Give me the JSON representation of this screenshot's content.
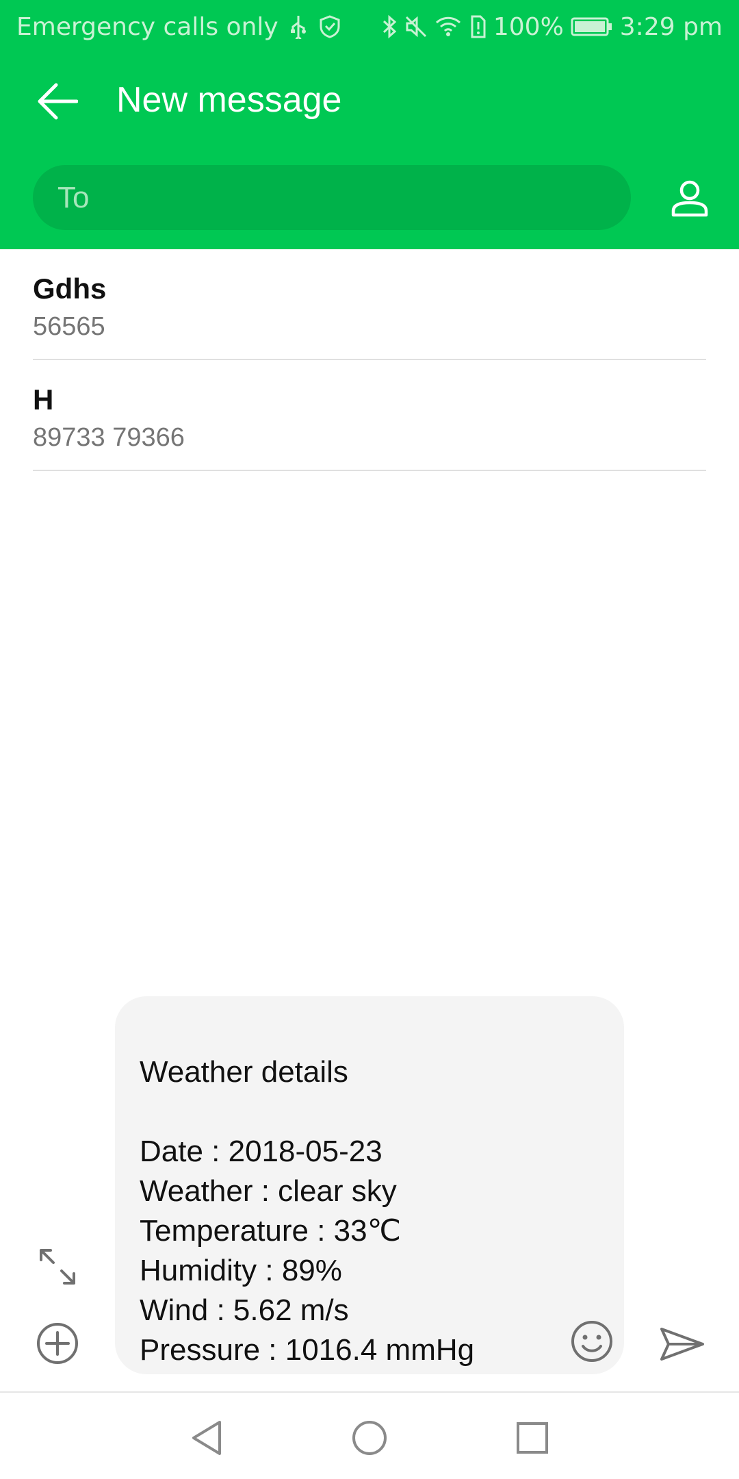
{
  "status_bar": {
    "carrier_text": "Emergency calls only",
    "battery_percent": "100%",
    "time": "3:29 pm",
    "icons": [
      "usb-icon",
      "shield-icon",
      "bluetooth-icon",
      "mute-icon",
      "wifi-icon",
      "sim-icon",
      "battery-icon"
    ]
  },
  "app_bar": {
    "title": "New message",
    "to_placeholder": "To",
    "back_icon": "arrow-left-icon",
    "contact_icon": "person-icon"
  },
  "suggestions": [
    {
      "name": "Gdhs",
      "number": "56565"
    },
    {
      "name": "H",
      "number": "89733 79366"
    }
  ],
  "compose": {
    "message": "Weather details\n\nDate : 2018-05-23\nWeather : clear sky\nTemperature : 33℃\nHumidity : 89%\nWind : 5.62 m/s\nPressure : 1016.4 mmHg"
  },
  "toolbar_icons": {
    "expand": "expand-icon",
    "attach": "add-circle-icon",
    "emoji": "emoji-icon",
    "send": "send-icon"
  },
  "nav_bar": {
    "icons": [
      "nav-back-icon",
      "nav-home-icon",
      "nav-recent-icon"
    ]
  },
  "colors": {
    "brand_green": "#00c853",
    "field_green": "#00b24a",
    "compose_bg": "#f4f4f4",
    "secondary_text": "#757575"
  }
}
